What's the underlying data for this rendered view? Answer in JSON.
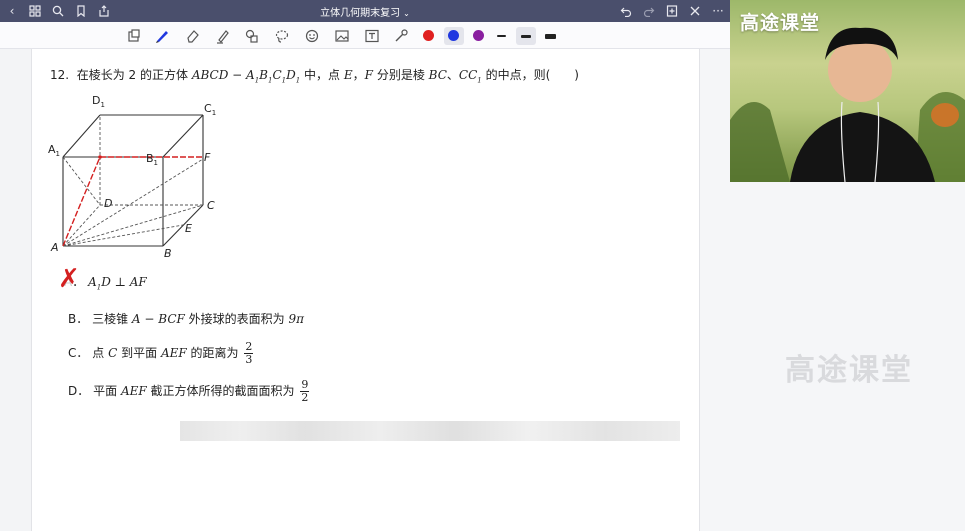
{
  "window": {
    "title": "立体几何期末复习",
    "title_caret": "⌄"
  },
  "toolbar": {
    "colors": [
      "#e02020",
      "#2038e0",
      "#8a1fa0"
    ]
  },
  "question": {
    "number": "12.",
    "stem_prefix": "在棱长为 2 的正方体",
    "cube_name": "ABCD − A",
    "cube_name_tail_1": "B",
    "cube_name_tail_2": "C",
    "cube_name_tail_3": "D",
    "sub1": "1",
    "stem_middle": "中，点",
    "point_e": "E",
    "sep_comma": "，",
    "point_f": "F",
    "stem_middle2": "分别是棱",
    "edge_bc": "BC",
    "sep_dun": "、",
    "edge_cc1": "CC",
    "stem_suffix": "的中点，则(　　)",
    "options": {
      "a": {
        "label": "A",
        "text_pre": "A",
        "text_post": "D ⊥ AF",
        "mark": "✗"
      },
      "b": {
        "label": "B",
        "text_pre": "三棱锥",
        "math": "A − BCF",
        "text_post": "外接球的表面积为",
        "value": "9π"
      },
      "c": {
        "label": "C",
        "text_pre": "点",
        "math_point": "C",
        "text_mid": "到平面",
        "math_plane": "AEF",
        "text_post": "的距离为",
        "num": "2",
        "den": "3"
      },
      "d": {
        "label": "D",
        "text_pre": "平面",
        "math_plane": "AEF",
        "text_post": "截正方体所得的截面面积为",
        "num": "9",
        "den": "2"
      }
    }
  },
  "figure": {
    "labels": {
      "d1": "D",
      "c1": "C",
      "a1": "A",
      "b1": "B",
      "f": "F",
      "d": "D",
      "c": "C",
      "a": "A",
      "b": "B",
      "e": "E",
      "sub": "1"
    }
  },
  "camera": {
    "brand": "高途课堂"
  },
  "watermark": "高途课堂"
}
